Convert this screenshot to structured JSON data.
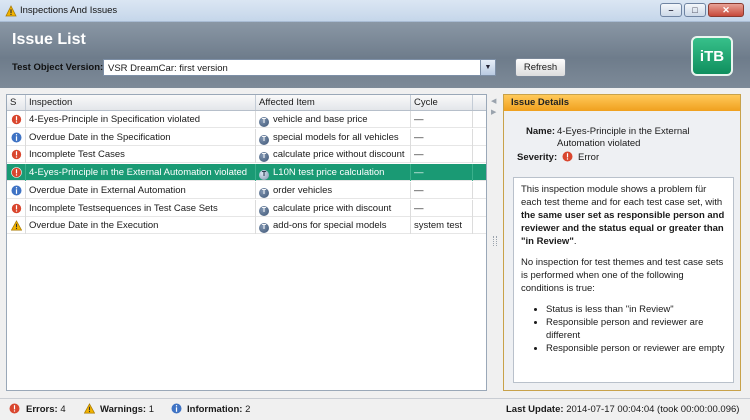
{
  "window": {
    "title": "Inspections And Issues"
  },
  "header": {
    "page_title": "Issue List",
    "version_label": "Test Object Version:",
    "version_value": "VSR DreamCar: first version",
    "refresh_label": "Refresh",
    "logo_text": "iTB"
  },
  "table": {
    "columns": [
      "S",
      "Inspection",
      "Affected Item",
      "Cycle"
    ],
    "rows": [
      {
        "severity": "error",
        "inspection": "4-Eyes-Principle in Specification violated",
        "item_icon": "T",
        "item": "vehicle and base price",
        "cycle": "—"
      },
      {
        "severity": "info",
        "inspection": "Overdue Date in the Specification",
        "item_icon": "T",
        "item": "special models for all vehicles",
        "cycle": "—"
      },
      {
        "severity": "error",
        "inspection": "Incomplete Test Cases",
        "item_icon": "T",
        "item": "calculate price without discount",
        "cycle": "—"
      },
      {
        "severity": "error",
        "inspection": "4-Eyes-Principle in the External Automation violated",
        "item_icon": "T",
        "item": "L10N test price calculation",
        "cycle": "—",
        "selected": true
      },
      {
        "severity": "info",
        "inspection": "Overdue Date in External Automation",
        "item_icon": "T",
        "item": "order vehicles",
        "cycle": "—"
      },
      {
        "severity": "error",
        "inspection": "Incomplete Testsequences in Test Case Sets",
        "item_icon": "T",
        "item": "calculate price with discount",
        "cycle": "—"
      },
      {
        "severity": "warning",
        "inspection": "Overdue Date in the Execution",
        "item_icon": "T",
        "item": "add-ons for special models",
        "cycle": "system test"
      }
    ]
  },
  "details": {
    "heading": "Issue Details",
    "name_label": "Name:",
    "name_value": "4-Eyes-Principle in the External Automation violated",
    "severity_label": "Severity:",
    "severity_value": "Error",
    "desc_p1_start": "This inspection module shows a problem für each test theme and for each test case set, with ",
    "desc_p1_bold": "the same user set as responsible person and reviewer and the status equal or greater than \"in Review\"",
    "desc_p1_end": ".",
    "desc_p2": "No inspection for test themes and test case sets is performed when one of the following conditions is true:",
    "desc_items": [
      "Status is less than \"in Review\"",
      "Responsible person and reviewer are different",
      "Responsible person or reviewer are empty"
    ]
  },
  "status": {
    "errors_label": "Errors:",
    "errors_count": "4",
    "warnings_label": "Warnings:",
    "warnings_count": "1",
    "info_label": "Information:",
    "info_count": "2",
    "update_label": "Last Update:",
    "update_value": "2014-07-17  00:04:04  (took 00:00:00.096)"
  },
  "colors": {
    "selection": "#1a9a74",
    "error": "#d9462e",
    "info": "#3f73c4",
    "warning": "#f2b300",
    "details_header": "#f0a01e"
  }
}
